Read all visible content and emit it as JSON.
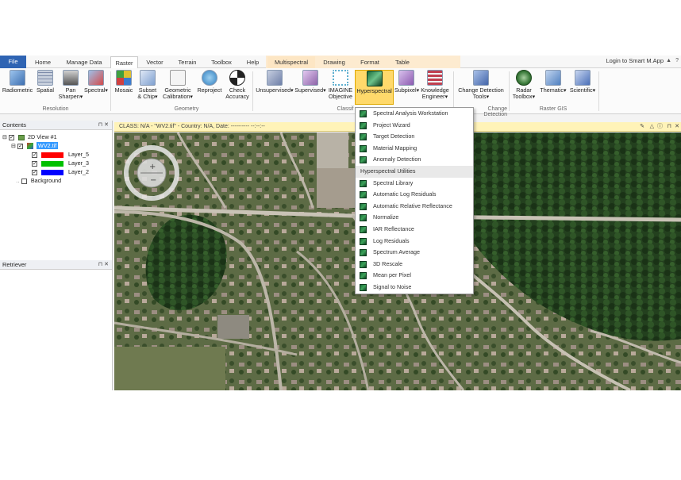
{
  "tabs": [
    "File",
    "Home",
    "Manage Data",
    "Raster",
    "Vector",
    "Terrain",
    "Toolbox",
    "Help",
    "Multispectral",
    "Drawing",
    "Format",
    "Table"
  ],
  "login_text": "Login to Smart M.App",
  "ribbon": {
    "buttons": [
      {
        "label1": "Radiometric",
        "label2": "",
        "color": "#6aa0d8"
      },
      {
        "label1": "Spatial",
        "label2": "",
        "color": "#7c8aa8"
      },
      {
        "label1": "Pan",
        "label2": "Sharpen",
        "color": "#8a8a8a"
      },
      {
        "label1": "Spectral",
        "label2": "",
        "color": "#5c86c2"
      },
      {
        "label1": "Mosaic",
        "label2": "",
        "color": "#e0c030"
      },
      {
        "label1": "Subset",
        "label2": "& Chip",
        "color": "#7fa0d0"
      },
      {
        "label1": "Geometric",
        "label2": "Calibration",
        "color": "#b0b0b0"
      },
      {
        "label1": "Reproject",
        "label2": "",
        "color": "#4f9bd6"
      },
      {
        "label1": "Check",
        "label2": "Accuracy",
        "color": "#222222"
      },
      {
        "label1": "Unsupervised",
        "label2": "",
        "color": "#6e7fa8"
      },
      {
        "label1": "Supervised",
        "label2": "",
        "color": "#8d63a8"
      },
      {
        "label1": "IMAGINE",
        "label2": "Objective",
        "color": "#5fb0d0"
      },
      {
        "label1": "Hyperspectral",
        "label2": "",
        "color": "#2a7a44"
      },
      {
        "label1": "Subpixel",
        "label2": "",
        "color": "#8c5ab0"
      },
      {
        "label1": "Knowledge",
        "label2": "Engineer",
        "color": "#c04050"
      },
      {
        "label1": "Change Detection",
        "label2": "Tools",
        "color": "#4466aa"
      },
      {
        "label1": "Radar",
        "label2": "Toolbox",
        "color": "#3a7a3a"
      },
      {
        "label1": "Thematic",
        "label2": "",
        "color": "#5080c0"
      },
      {
        "label1": "Scientific",
        "label2": "",
        "color": "#4a6fb8"
      }
    ],
    "groups": [
      "Resolution",
      "Geometry",
      "Classif",
      "Change Detection",
      "Raster GIS"
    ]
  },
  "contents": {
    "title": "Contents",
    "view": "2D View #1",
    "file": "WV2.tif",
    "layers": [
      {
        "name": "Layer_5",
        "color": "#ff0000"
      },
      {
        "name": "Layer_3",
        "color": "#00c000"
      },
      {
        "name": "Layer_2",
        "color": "#0000ff"
      }
    ],
    "background": "Background"
  },
  "retriever": {
    "title": "Retriever"
  },
  "view_header": "CLASS: N/A - \"WV2.tif\" - Country: N/A, Date: ---------- --:--:--",
  "menu": {
    "items_top": [
      "Spectral Analysis Workstation",
      "Project Wizard",
      "Target Detection",
      "Material Mapping",
      "Anomaly Detection"
    ],
    "section": "Hyperspectral Utilities",
    "items_bottom": [
      "Spectral Library",
      "Automatic Log Residuals",
      "Automatic Relative Reflectance",
      "Normalize",
      "IAR Reflectance",
      "Log Residuals",
      "Spectrum Average",
      "3D Rescale",
      "Mean per Pixel",
      "Signal to Noise"
    ]
  }
}
